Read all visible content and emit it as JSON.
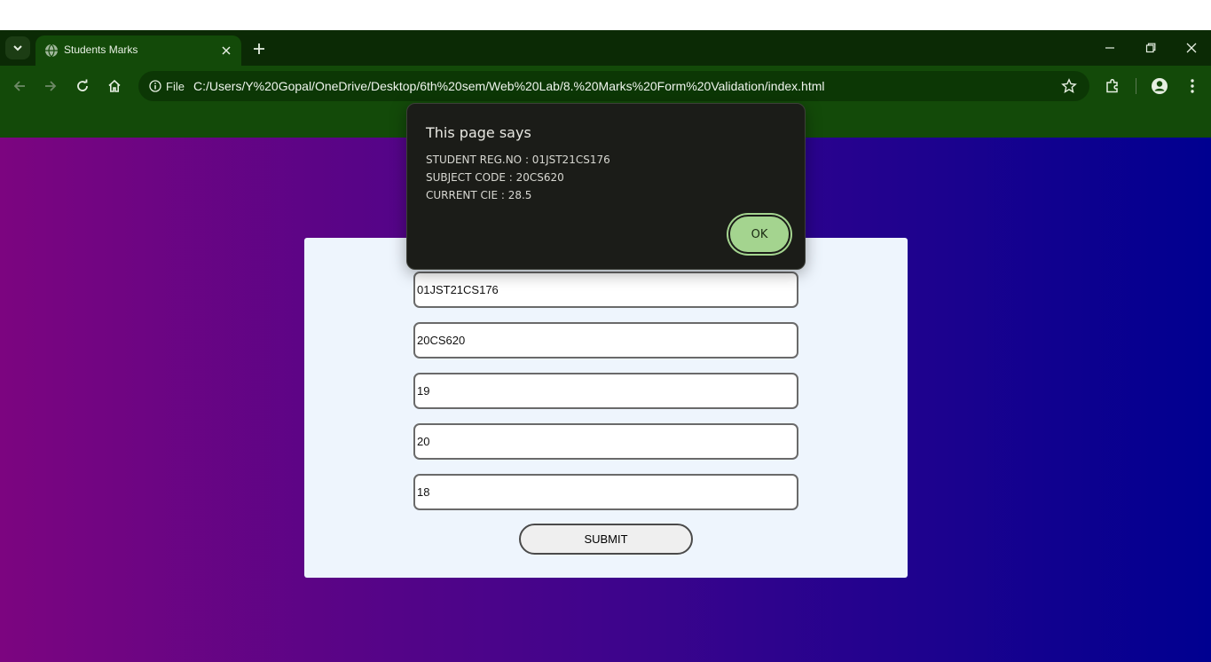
{
  "browser": {
    "tab": {
      "title": "Students Marks"
    },
    "address": {
      "site_label": "File",
      "url": "C:/Users/Y%20Gopal/OneDrive/Desktop/6th%20sem/Web%20Lab/8.%20Marks%20Form%20Validation/index.html"
    }
  },
  "form": {
    "fields": [
      {
        "value": "01JST21CS176"
      },
      {
        "value": "20CS620"
      },
      {
        "value": "19"
      },
      {
        "value": "20"
      },
      {
        "value": "18"
      }
    ],
    "submit_label": "SUBMIT"
  },
  "alert": {
    "title": "This page says",
    "lines": [
      "STUDENT REG.NO : 01JST21CS176",
      "SUBJECT CODE : 20CS620",
      "CURRENT CIE : 28.5"
    ],
    "ok_label": "OK"
  },
  "theme": {
    "chrome_dark": "#0b2a05",
    "chrome": "#134a09",
    "page_gradient_start": "#7c0580",
    "page_gradient_end": "#000090",
    "card_bg": "#eef5fd",
    "dialog_bg": "#1b1c18",
    "ok_button": "#a4d48f"
  },
  "icons": [
    "chevron-down-icon",
    "globe-icon",
    "close-icon",
    "plus-icon",
    "minimize-icon",
    "restore-icon",
    "window-close-icon",
    "back-arrow-icon",
    "forward-arrow-icon",
    "reload-icon",
    "home-icon",
    "info-icon",
    "star-icon",
    "extensions-icon",
    "profile-icon",
    "more-vert-icon"
  ]
}
